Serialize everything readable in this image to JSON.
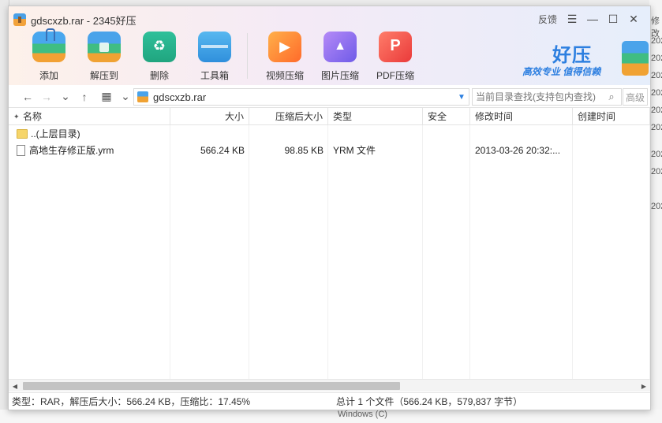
{
  "window": {
    "title": "gdscxzb.rar - 2345好压",
    "feedback_label": "反馈",
    "menu_icon": "menu-icon",
    "minimize_icon": "minimize-icon",
    "maximize_icon": "maximize-icon",
    "close_icon": "close-icon"
  },
  "toolbar": {
    "add": "添加",
    "extract": "解压到",
    "delete": "删除",
    "tools": "工具箱",
    "video": "视频压缩",
    "image": "图片压缩",
    "pdf": "PDF压缩"
  },
  "brand": {
    "name": "好压",
    "slogan": "高效专业 值得信赖"
  },
  "address": {
    "path": "gdscxzb.rar",
    "search_placeholder": "当前目录查找(支持包内查找)",
    "search_button": "高级"
  },
  "columns": [
    "名称",
    "大小",
    "压缩后大小",
    "类型",
    "安全",
    "修改时间",
    "创建时间"
  ],
  "rows": [
    {
      "name": "..(上层目录)",
      "size": "",
      "packed": "",
      "type": "",
      "security": "",
      "mtime": "",
      "ctime": ""
    },
    {
      "name": "高地生存修正版.yrm",
      "size": "566.24 KB",
      "packed": "98.85 KB",
      "type": "YRM 文件",
      "security": "",
      "mtime": "2013-03-26 20:32:...",
      "ctime": ""
    }
  ],
  "status": {
    "left": "类型：RAR，解压后大小：566.24 KB，压缩比：17.45%",
    "right": "总计 1 个文件（566.24 KB，579,837 字节）"
  },
  "background": {
    "right_fragments": [
      "修改",
      "202",
      "202",
      "202",
      "202",
      "202",
      "202",
      "202",
      "202",
      "202"
    ],
    "bottom_fragment": "Windows (C)"
  }
}
